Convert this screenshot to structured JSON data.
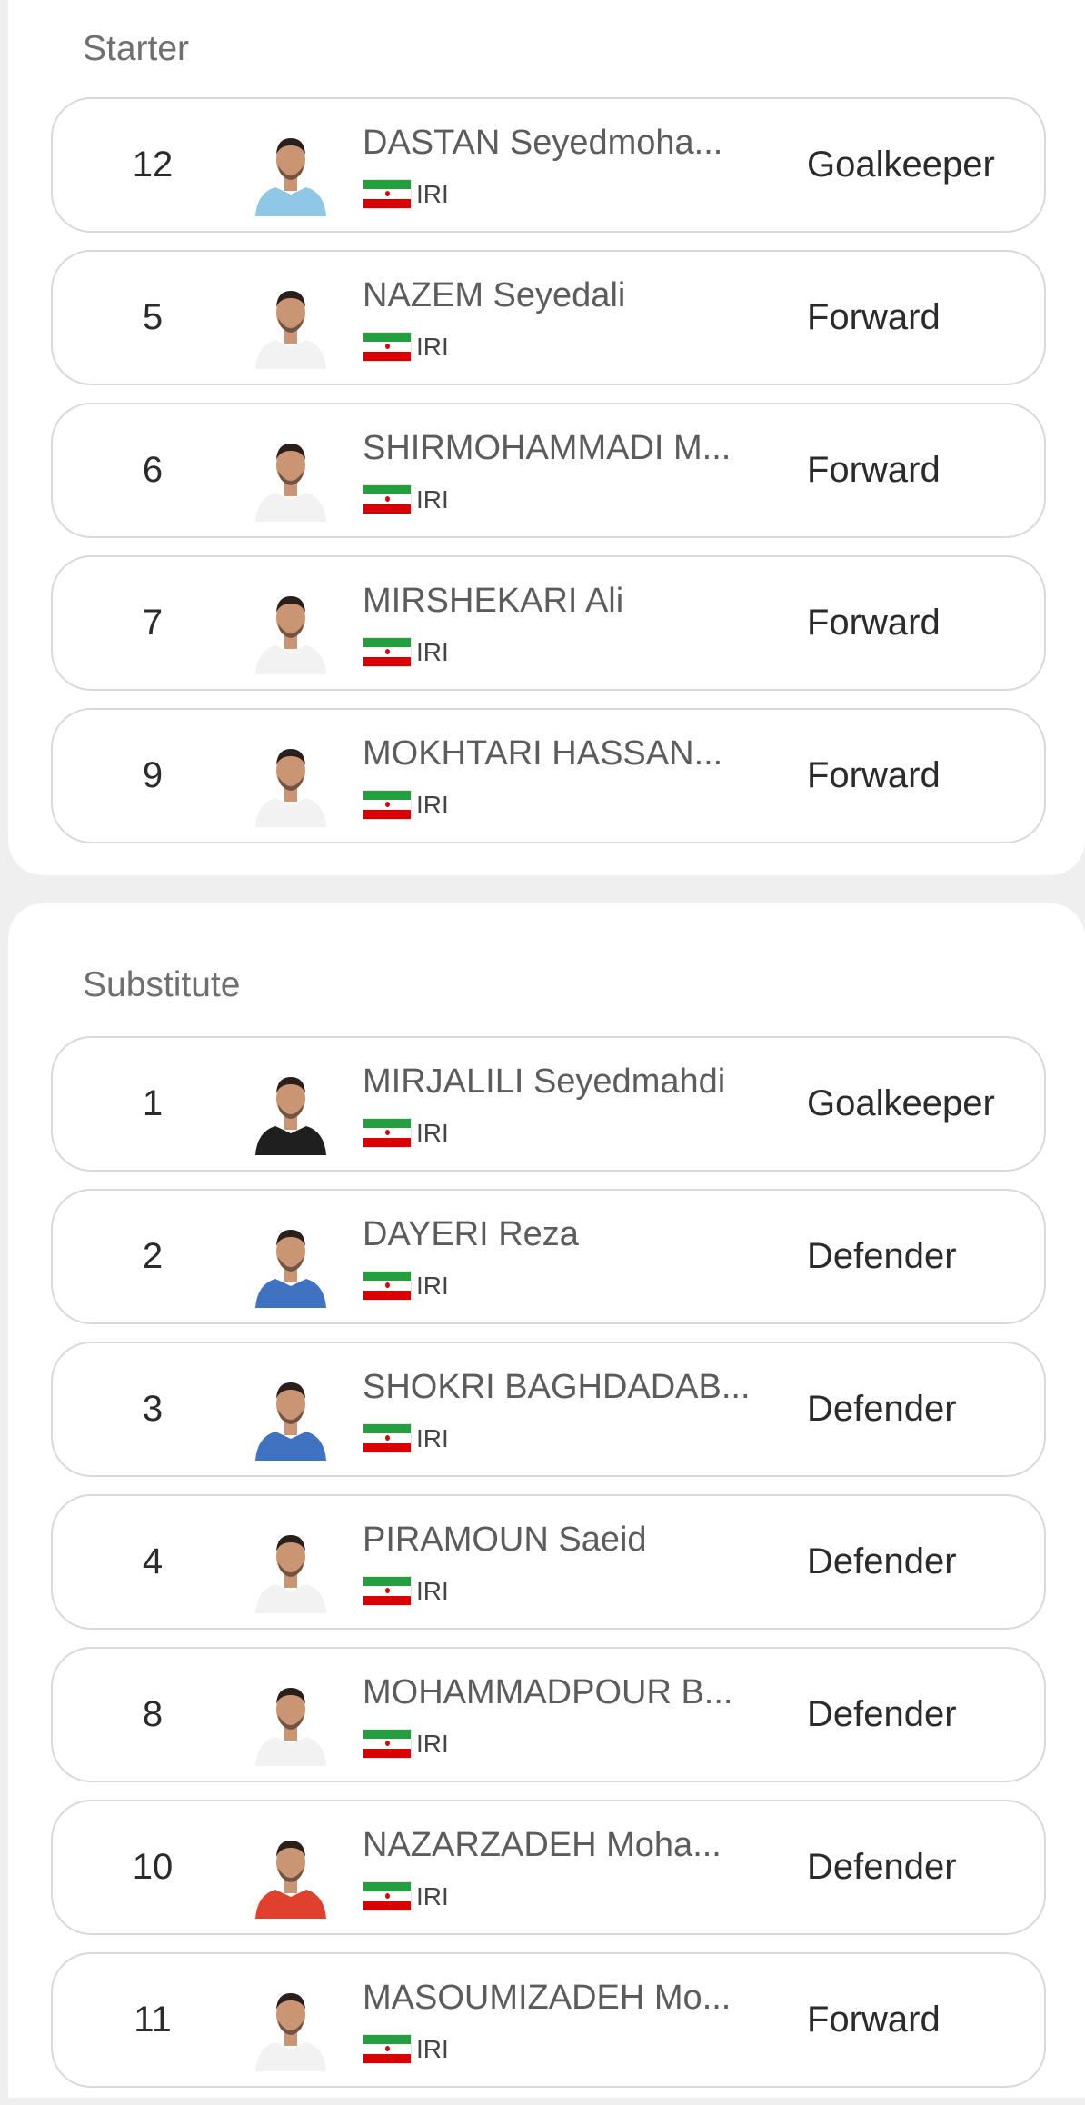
{
  "sections": {
    "starter": {
      "title": "Starter",
      "players": [
        {
          "number": "12",
          "name": "DASTAN Seyedmoha...",
          "country": "IRI",
          "position": "Goalkeeper",
          "kit": "light-blue"
        },
        {
          "number": "5",
          "name": "NAZEM Seyedali",
          "country": "IRI",
          "position": "Forward",
          "kit": "white"
        },
        {
          "number": "6",
          "name": "SHIRMOHAMMADI M...",
          "country": "IRI",
          "position": "Forward",
          "kit": "white"
        },
        {
          "number": "7",
          "name": "MIRSHEKARI Ali",
          "country": "IRI",
          "position": "Forward",
          "kit": "white"
        },
        {
          "number": "9",
          "name": "MOKHTARI HASSAN...",
          "country": "IRI",
          "position": "Forward",
          "kit": "white"
        }
      ]
    },
    "substitute": {
      "title": "Substitute",
      "players": [
        {
          "number": "1",
          "name": "MIRJALILI Seyedmahdi",
          "country": "IRI",
          "position": "Goalkeeper",
          "kit": "black"
        },
        {
          "number": "2",
          "name": "DAYERI Reza",
          "country": "IRI",
          "position": "Defender",
          "kit": "blue"
        },
        {
          "number": "3",
          "name": "SHOKRI BAGHDADAB...",
          "country": "IRI",
          "position": "Defender",
          "kit": "blue"
        },
        {
          "number": "4",
          "name": "PIRAMOUN Saeid",
          "country": "IRI",
          "position": "Defender",
          "kit": "white"
        },
        {
          "number": "8",
          "name": "MOHAMMADPOUR B...",
          "country": "IRI",
          "position": "Defender",
          "kit": "white"
        },
        {
          "number": "10",
          "name": "NAZARZADEH Moha...",
          "country": "IRI",
          "position": "Defender",
          "kit": "red"
        },
        {
          "number": "11",
          "name": "MASOUMIZADEH Mo...",
          "country": "IRI",
          "position": "Forward",
          "kit": "white"
        }
      ]
    }
  },
  "colors": {
    "flag_green": "#239f40",
    "flag_white": "#ffffff",
    "flag_red": "#da0000",
    "kit_light-blue": "#8fc8e6",
    "kit_white": "#f2f2f2",
    "kit_black": "#1f1f1f",
    "kit_blue": "#3f73c2",
    "kit_red": "#e0412f",
    "skin": "#c99572",
    "hair": "#2a1f1a"
  }
}
